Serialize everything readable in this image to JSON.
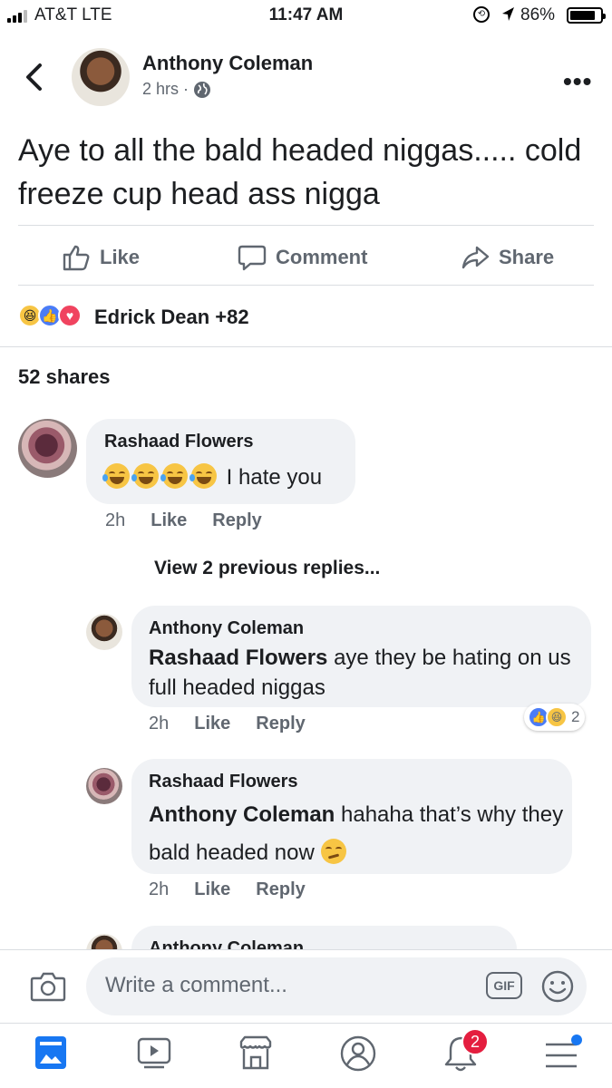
{
  "status_bar": {
    "carrier": "AT&T  LTE",
    "time": "11:47 AM",
    "battery": "86%",
    "battery_level": 0.86
  },
  "post": {
    "author": "Anthony Coleman",
    "time": "2 hrs",
    "separator": "·",
    "text": "Aye to all the bald headed niggas..... cold freeze cup head ass nigga",
    "actions": {
      "like": "Like",
      "comment": "Comment",
      "share": "Share"
    },
    "reactions": {
      "icons": [
        "haha-icon",
        "like-icon",
        "love-icon"
      ],
      "summary": "Edrick Dean +82"
    },
    "shares": "52 shares"
  },
  "comments": [
    {
      "author": "Rashaad Flowers",
      "text": "I hate you",
      "emoji": [
        "joy-icon",
        "joy-icon",
        "joy-icon",
        "joy-icon"
      ],
      "time": "2h",
      "like": "Like",
      "reply": "Reply"
    }
  ],
  "view_previous": "View 2 previous replies...",
  "replies": [
    {
      "author": "Anthony Coleman",
      "mention": "Rashaad Flowers",
      "text": " aye they be hating on us full headed niggas",
      "time": "2h",
      "like": "Like",
      "reply": "Reply",
      "reaction_count": "2"
    },
    {
      "author": "Rashaad Flowers",
      "mention": "Anthony Coleman",
      "text": "  hahaha that’s why they bald headed now",
      "emoji": "woozy-face-icon",
      "time": "2h",
      "like": "Like",
      "reply": "Reply"
    },
    {
      "author": "Anthony Coleman"
    }
  ],
  "composer": {
    "placeholder": "Write a comment...",
    "gif": "GIF"
  },
  "tabbar": {
    "notifications_badge": "2"
  },
  "colors": {
    "accent": "#1877f2",
    "secondary_text": "#606770",
    "bubble": "#f0f2f5",
    "badge": "#e41e3f"
  }
}
